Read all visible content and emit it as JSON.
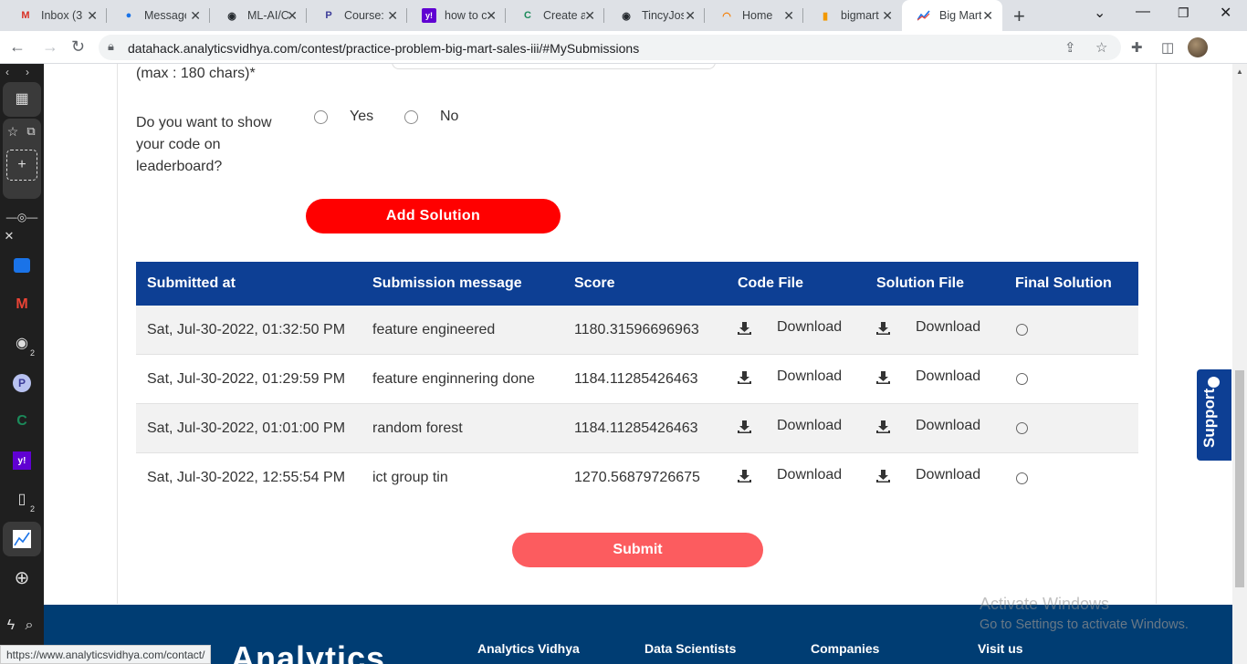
{
  "browser": {
    "tabs": [
      {
        "label": "Inbox (3",
        "icon": "gmail-icon",
        "glyph": "M",
        "color": "#d93025"
      },
      {
        "label": "Message",
        "icon": "google-messages-icon",
        "glyph": "●",
        "color": "#1a73e8"
      },
      {
        "label": "ML-AI/C",
        "icon": "github-icon",
        "glyph": "◉",
        "color": "#24292e"
      },
      {
        "label": "Course:",
        "icon": "p-logo-icon",
        "glyph": "P",
        "color": "#3b3b98"
      },
      {
        "label": "how to c",
        "icon": "yahoo-icon",
        "glyph": "y!",
        "color": "#6001d2"
      },
      {
        "label": "Create a",
        "icon": "c-logo-icon",
        "glyph": "C",
        "color": "#1b8a5a"
      },
      {
        "label": "TincyJos",
        "icon": "github-icon",
        "glyph": "◉",
        "color": "#24292e"
      },
      {
        "label": "Home",
        "icon": "loading-icon",
        "glyph": "◠",
        "color": "#f57c00"
      },
      {
        "label": "bigmart",
        "icon": "book-icon",
        "glyph": "▮",
        "color": "#f29900"
      },
      {
        "label": "Big Mart",
        "icon": "chart-line-icon",
        "glyph": "〰",
        "color": "#1a73e8"
      }
    ],
    "url": "datahack.analyticsvidhya.com/contest/practice-problem-big-mart-sales-iii/#MySubmissions",
    "status_url": "https://www.analyticsvidhya.com/contact/"
  },
  "form": {
    "max_chars_label": "(max : 180 chars)*",
    "show_code_question": "Do you want to show your code on leaderboard?",
    "yes_label": "Yes",
    "no_label": "No",
    "add_solution_label": "Add Solution",
    "submit_label": "Submit"
  },
  "table": {
    "headers": [
      "Submitted at",
      "Submission message",
      "Score",
      "Code File",
      "Solution File",
      "Final Solution"
    ],
    "rows": [
      {
        "submitted_at": "Sat, Jul-30-2022, 01:32:50 PM",
        "message": "feature engineered",
        "score": "1180.31596696963",
        "code_file": "Download",
        "solution_file": "Download"
      },
      {
        "submitted_at": "Sat, Jul-30-2022, 01:29:59 PM",
        "message": "feature enginnering done",
        "score": "1184.11285426463",
        "code_file": "Download",
        "solution_file": "Download"
      },
      {
        "submitted_at": "Sat, Jul-30-2022, 01:01:00 PM",
        "message": "random forest",
        "score": "1184.11285426463",
        "code_file": "Download",
        "solution_file": "Download"
      },
      {
        "submitted_at": "Sat, Jul-30-2022, 12:55:54 PM",
        "message": "ict group tin",
        "score": "1270.56879726675",
        "code_file": "Download",
        "solution_file": "Download"
      }
    ]
  },
  "footer": {
    "logo_text": "Analytics",
    "columns": [
      "Analytics Vidhya",
      "Data Scientists",
      "Companies",
      "Visit us"
    ]
  },
  "support_label": "Support",
  "watermark": {
    "line1": "Activate Windows",
    "line2": "Go to Settings to activate Windows."
  },
  "colors": {
    "header_blue": "#0d3f94",
    "add_solution_red": "#ff0000",
    "submit_red": "#fc5c5f",
    "footer_navy": "#003d73"
  }
}
